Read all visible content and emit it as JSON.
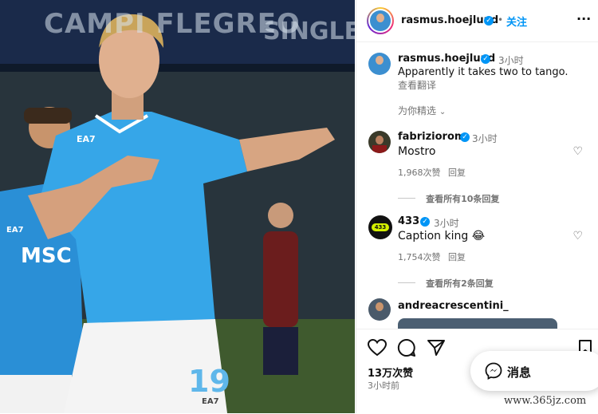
{
  "post": {
    "username": "rasmus.hoejlund",
    "follow_label": "关注",
    "more_label": "···"
  },
  "photo": {
    "banner_left": "CAMPI FLEGREO",
    "banner_right": "SINGLE",
    "sponsor": "MSC",
    "kit_brand": "EA7",
    "shirt_number": "19"
  },
  "caption": {
    "username": "rasmus.hoejlund",
    "time": "3小时",
    "text": "Apparently it takes two to tango.",
    "translate": "查看翻译"
  },
  "sort_label": "为你精选",
  "comments": [
    {
      "username": "fabriziorom",
      "time": "3小时",
      "text": "Mostro",
      "likes": "1,968次赞",
      "reply": "回复",
      "view_replies": "查看所有10条回复"
    },
    {
      "username": "433",
      "time": "3小时",
      "text": "Caption king",
      "emoji": "😂",
      "likes": "1,754次赞",
      "reply": "回复",
      "view_replies": "查看所有2条回复"
    },
    {
      "username": "andreacrescentini_"
    }
  ],
  "stats": {
    "likes": "13万次赞",
    "time": "3小时前"
  },
  "messages_label": "消息",
  "watermark": "www.365jz.com"
}
